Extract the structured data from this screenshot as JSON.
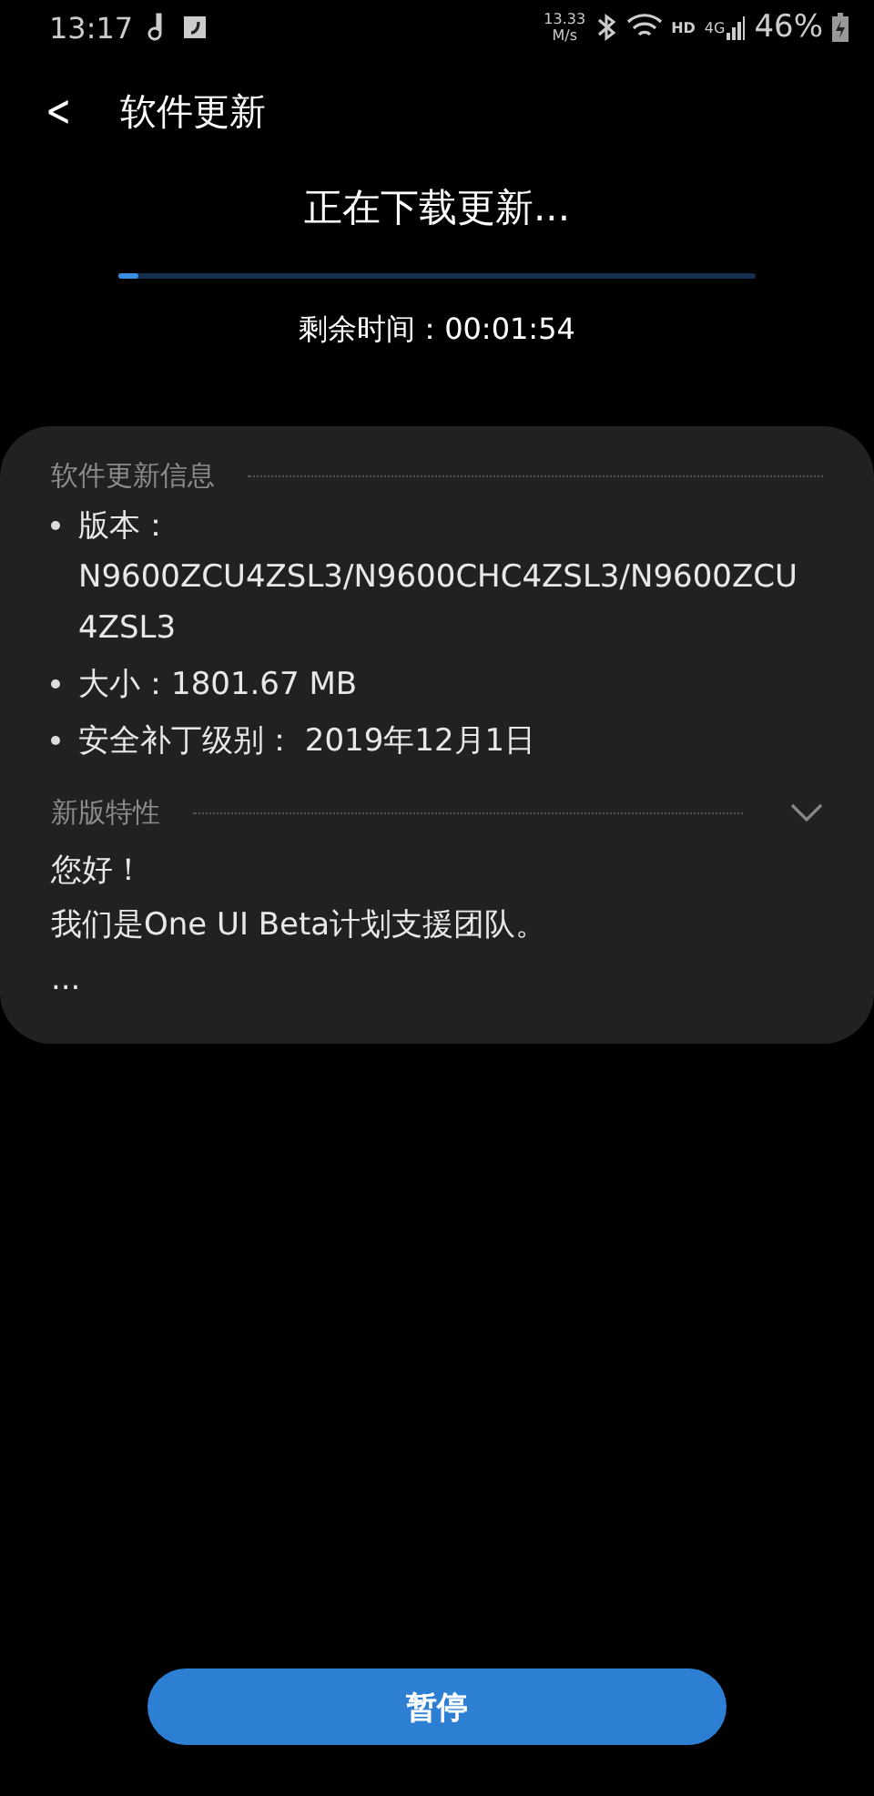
{
  "status_bar": {
    "time": "13:17",
    "speed": "13.33",
    "speed_unit": "M/s",
    "hd": "HD",
    "network": "4G",
    "battery": "46%"
  },
  "header": {
    "back": "<",
    "title": "软件更新"
  },
  "download": {
    "title": "正在下载更新...",
    "level": 0.03,
    "remaining": "剩余时间：00:01:54"
  },
  "info": {
    "heading": "软件更新信息",
    "items": [
      "版本：N9600ZCU4ZSL3/N9600CHC4ZSL3/N9600ZCU4ZSL3",
      "大小：1801.67 MB",
      "安全补丁级别： 2019年12月1日"
    ]
  },
  "features": {
    "heading": "新版特性",
    "expanded": false,
    "lines": [
      "您好！",
      "我们是One UI Beta计划支援团队。",
      "..."
    ]
  },
  "button": "暂停"
}
